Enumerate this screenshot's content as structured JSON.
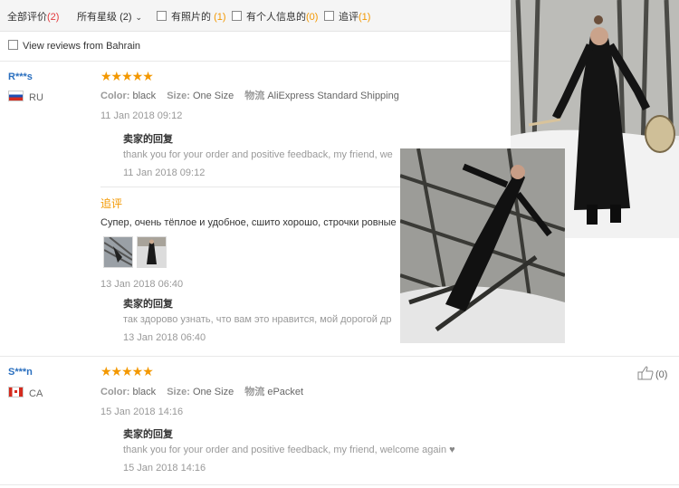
{
  "filters": {
    "all_label": "全部评价",
    "all_count": "(2)",
    "stars_label": "所有星级",
    "stars_count": "(2)",
    "photo_label": "有照片的",
    "photo_count": "(1)",
    "info_label": "有个人信息的",
    "info_count": "(0)",
    "follow_label": "追评",
    "follow_count": "(1)",
    "bahrain_label": "View reviews from Bahrain"
  },
  "reviews": [
    {
      "user": "R***s",
      "country": "RU",
      "stars": "★★★★★",
      "color_key": "Color:",
      "color_val": "black",
      "size_key": "Size:",
      "size_val": "One Size",
      "ship_key": "物流",
      "ship_val": "AliExpress Standard Shipping",
      "date": "11 Jan 2018 09:12",
      "reply_title": "卖家的回复",
      "reply_text": "thank you for your order and positive feedback, my friend, we",
      "reply_date": "11 Jan 2018 09:12",
      "followup_title": "追评",
      "followup_text": "Супер, очень тёплое и удобное, сшито хорошо, строчки ровные",
      "followup_date": "13 Jan 2018 06:40",
      "reply2_title": "卖家的回复",
      "reply2_text": "так здорово узнать, что вам это нравится, мой дорогой др",
      "reply2_date": "13 Jan 2018 06:40"
    },
    {
      "user": "S***n",
      "country": "CA",
      "stars": "★★★★★",
      "color_key": "Color:",
      "color_val": "black",
      "size_key": "Size:",
      "size_val": "One Size",
      "ship_key": "物流",
      "ship_val": "ePacket",
      "date": "15 Jan 2018 14:16",
      "reply_title": "卖家的回复",
      "reply_text": "thank you for your order and positive feedback, my friend, welcome again",
      "reply_heart": "♥",
      "reply_date": "15 Jan 2018 14:16",
      "likes": "(0)"
    }
  ]
}
